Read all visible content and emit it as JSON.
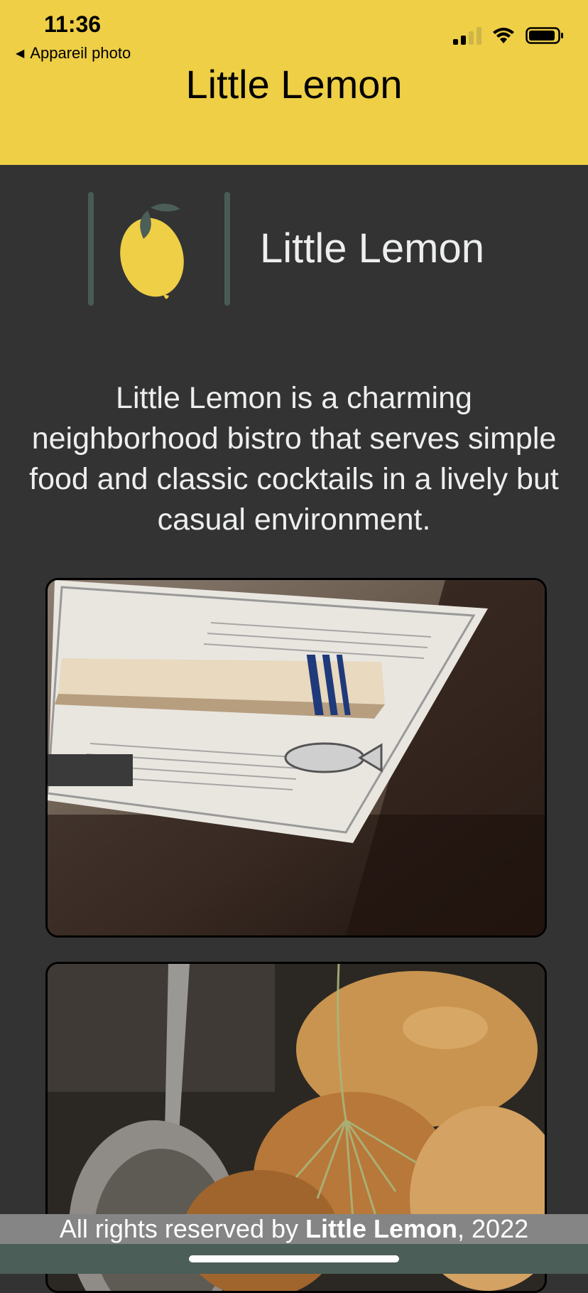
{
  "status_bar": {
    "time": "11:36",
    "back_label": "Appareil photo",
    "icons": [
      "signal-icon",
      "wifi-icon",
      "battery-icon"
    ]
  },
  "header": {
    "title": "Little Lemon",
    "background_color": "#EECF46"
  },
  "logo": {
    "text": "Little Lemon",
    "icon": "lemon-icon"
  },
  "main": {
    "description": "Little Lemon is a charming neighborhood bistro that serves simple food and classic cocktails in a lively but casual environment.",
    "background_color": "#333333",
    "images": [
      "table-setting-photo",
      "food-dish-photo"
    ]
  },
  "footer": {
    "prefix": "All rights reserved by ",
    "brand": "Little Lemon",
    "suffix": ", 2022"
  }
}
